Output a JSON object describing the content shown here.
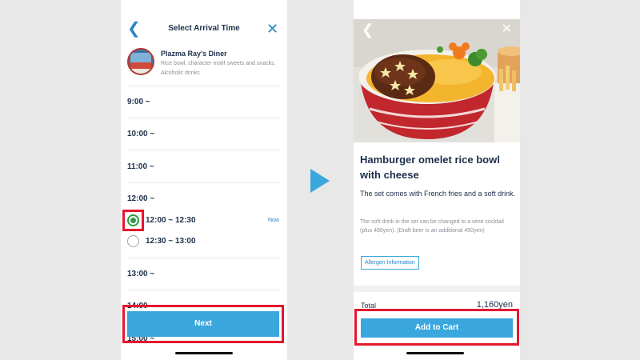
{
  "left_screen": {
    "header": {
      "back_icon": "chevron-left-icon",
      "title": "Select Arrival Time",
      "close_icon": "close-icon"
    },
    "restaurant": {
      "name": "Plazma Ray's Diner",
      "description": "Rice bowl, character motif sweets and snacks, Alcoholic drinks"
    },
    "time_groups": [
      "9:00 ~",
      "10:00 ~",
      "11:00 ~",
      "12:00 ~",
      "13:00 ~",
      "14:00 ~",
      "15:00 ~"
    ],
    "sub_slots": [
      {
        "label": "12:00 ~ 12:30",
        "selected": true,
        "badge": "Now"
      },
      {
        "label": "12:30 ~ 13:00",
        "selected": false,
        "badge": ""
      }
    ],
    "next_button": "Next"
  },
  "transition_arrow": "arrow-right-icon",
  "right_screen": {
    "photo_back_icon": "chevron-left-icon",
    "photo_close_icon": "close-icon",
    "dish_name": "Hamburger omelet rice bowl with cheese",
    "description": "The set comes with French fries and a soft drink.",
    "note": "The soft drink in the set can be changed to a wine cocktail (plus 480yen). (Draft beer is an additional 450yen)",
    "allergen_button": "Allergen Information",
    "total_label": "Total",
    "total_value": "1,160yen",
    "add_to_cart_button": "Add to Cart"
  },
  "colors": {
    "accent": "#3aa7dd",
    "highlight": "#e5172f",
    "selected_radio": "#2e9b45",
    "text_dark": "#1d2f4a",
    "background": "#e8e8e8"
  }
}
